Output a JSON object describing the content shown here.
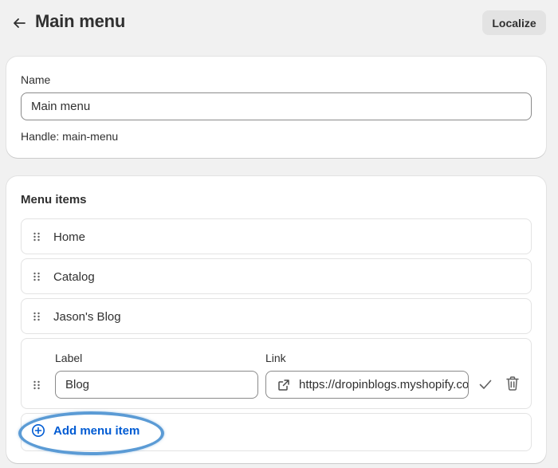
{
  "header": {
    "title": "Main menu",
    "localize_label": "Localize"
  },
  "name_card": {
    "name_label": "Name",
    "name_value": "Main menu",
    "handle_text": "Handle: main-menu"
  },
  "menu_card": {
    "title": "Menu items",
    "items": [
      {
        "label": "Home"
      },
      {
        "label": "Catalog"
      },
      {
        "label": "Jason's Blog"
      }
    ],
    "editing": {
      "label_heading": "Label",
      "link_heading": "Link",
      "label_value": "Blog",
      "link_value": "https://dropinblogs.myshopify.com/blogs/blog"
    },
    "add_label": "Add menu item"
  },
  "colors": {
    "accent": "#005bd3",
    "highlight": "#5b9bd5",
    "background": "#f1f1f1"
  },
  "icons": [
    "arrow-left-icon",
    "drag-handle-icon",
    "external-link-icon",
    "checkmark-icon",
    "trash-icon",
    "plus-circle-icon"
  ]
}
